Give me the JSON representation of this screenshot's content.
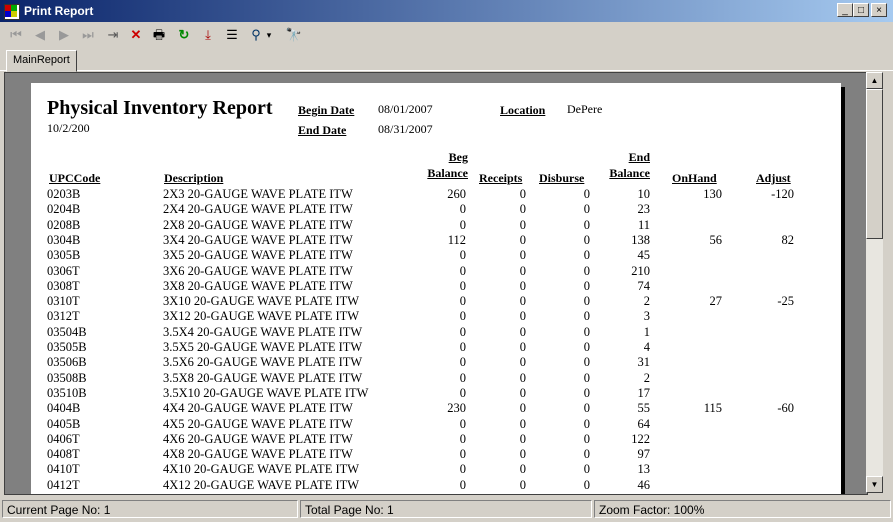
{
  "window": {
    "title": "Print Report",
    "min_label": "_",
    "max_label": "□",
    "close_label": "×"
  },
  "toolbar": {
    "icons": {
      "first": "⏮",
      "prev": "◀",
      "next": "▶",
      "last": "⏭",
      "goto": "⇥",
      "stop": "✕",
      "print": "🖶",
      "refresh": "↻",
      "export": "⤓",
      "tree": "☰",
      "zoom": "⚲",
      "zoom_arrow": "▾",
      "search": "🔭"
    }
  },
  "tabs": [
    "MainReport"
  ],
  "report": {
    "title": "Physical Inventory Report",
    "date": "10/2/200",
    "begin_date_label": "Begin Date",
    "begin_date": "08/01/2007",
    "end_date_label": "End Date",
    "end_date": "08/31/2007",
    "location_label": "Location",
    "location": "DePere",
    "columns": {
      "upc": "UPCCode",
      "desc": "Description",
      "beg1": "Beg",
      "beg2": "Balance",
      "receipts": "Receipts",
      "disburse": "Disburse",
      "end1": "End",
      "end2": "Balance",
      "onhand": "OnHand",
      "adjust": "Adjust"
    },
    "rows": [
      [
        "0203B",
        "2X3 20-GAUGE WAVE PLATE ITW",
        "260",
        "0",
        "0",
        "10",
        "130",
        "-120"
      ],
      [
        "0204B",
        "2X4 20-GAUGE WAVE PLATE ITW",
        "0",
        "0",
        "0",
        "23",
        "",
        ""
      ],
      [
        "0208B",
        "2X8 20-GAUGE WAVE PLATE ITW",
        "0",
        "0",
        "0",
        "11",
        "",
        ""
      ],
      [
        "0304B",
        "3X4 20-GAUGE WAVE PLATE ITW",
        "112",
        "0",
        "0",
        "138",
        "56",
        "82"
      ],
      [
        "0305B",
        "3X5 20-GAUGE WAVE PLATE ITW",
        "0",
        "0",
        "0",
        "45",
        "",
        ""
      ],
      [
        "0306T",
        "3X6 20-GAUGE WAVE PLATE ITW",
        "0",
        "0",
        "0",
        "210",
        "",
        ""
      ],
      [
        "0308T",
        "3X8 20-GAUGE WAVE PLATE ITW",
        "0",
        "0",
        "0",
        "74",
        "",
        ""
      ],
      [
        "0310T",
        "3X10 20-GAUGE WAVE PLATE ITW",
        "0",
        "0",
        "0",
        "2",
        "27",
        "-25"
      ],
      [
        "0312T",
        "3X12 20-GAUGE WAVE PLATE ITW",
        "0",
        "0",
        "0",
        "3",
        "",
        ""
      ],
      [
        "03504B",
        "3.5X4 20-GAUGE WAVE PLATE ITW",
        "0",
        "0",
        "0",
        "1",
        "",
        ""
      ],
      [
        "03505B",
        "3.5X5 20-GAUGE WAVE PLATE ITW",
        "0",
        "0",
        "0",
        "4",
        "",
        ""
      ],
      [
        "03506B",
        "3.5X6 20-GAUGE WAVE PLATE ITW",
        "0",
        "0",
        "0",
        "31",
        "",
        ""
      ],
      [
        "03508B",
        "3.5X8 20-GAUGE WAVE PLATE ITW",
        "0",
        "0",
        "0",
        "2",
        "",
        ""
      ],
      [
        "03510B",
        "3.5X10 20-GAUGE WAVE PLATE ITW",
        "0",
        "0",
        "0",
        "17",
        "",
        ""
      ],
      [
        "0404B",
        "4X4 20-GAUGE WAVE PLATE ITW",
        "230",
        "0",
        "0",
        "55",
        "115",
        "-60"
      ],
      [
        "0405B",
        "4X5 20-GAUGE WAVE PLATE ITW",
        "0",
        "0",
        "0",
        "64",
        "",
        ""
      ],
      [
        "0406T",
        "4X6 20-GAUGE WAVE PLATE ITW",
        "0",
        "0",
        "0",
        "122",
        "",
        ""
      ],
      [
        "0408T",
        "4X8 20-GAUGE WAVE PLATE ITW",
        "0",
        "0",
        "0",
        "97",
        "",
        ""
      ],
      [
        "0410T",
        "4X10 20-GAUGE WAVE PLATE ITW",
        "0",
        "0",
        "0",
        "13",
        "",
        ""
      ],
      [
        "0412T",
        "4X12 20-GAUGE WAVE PLATE ITW",
        "0",
        "0",
        "0",
        "46",
        "",
        ""
      ]
    ]
  },
  "status": {
    "current": "Current Page No: 1",
    "total": "Total Page No: 1",
    "zoom": "Zoom Factor: 100%"
  }
}
